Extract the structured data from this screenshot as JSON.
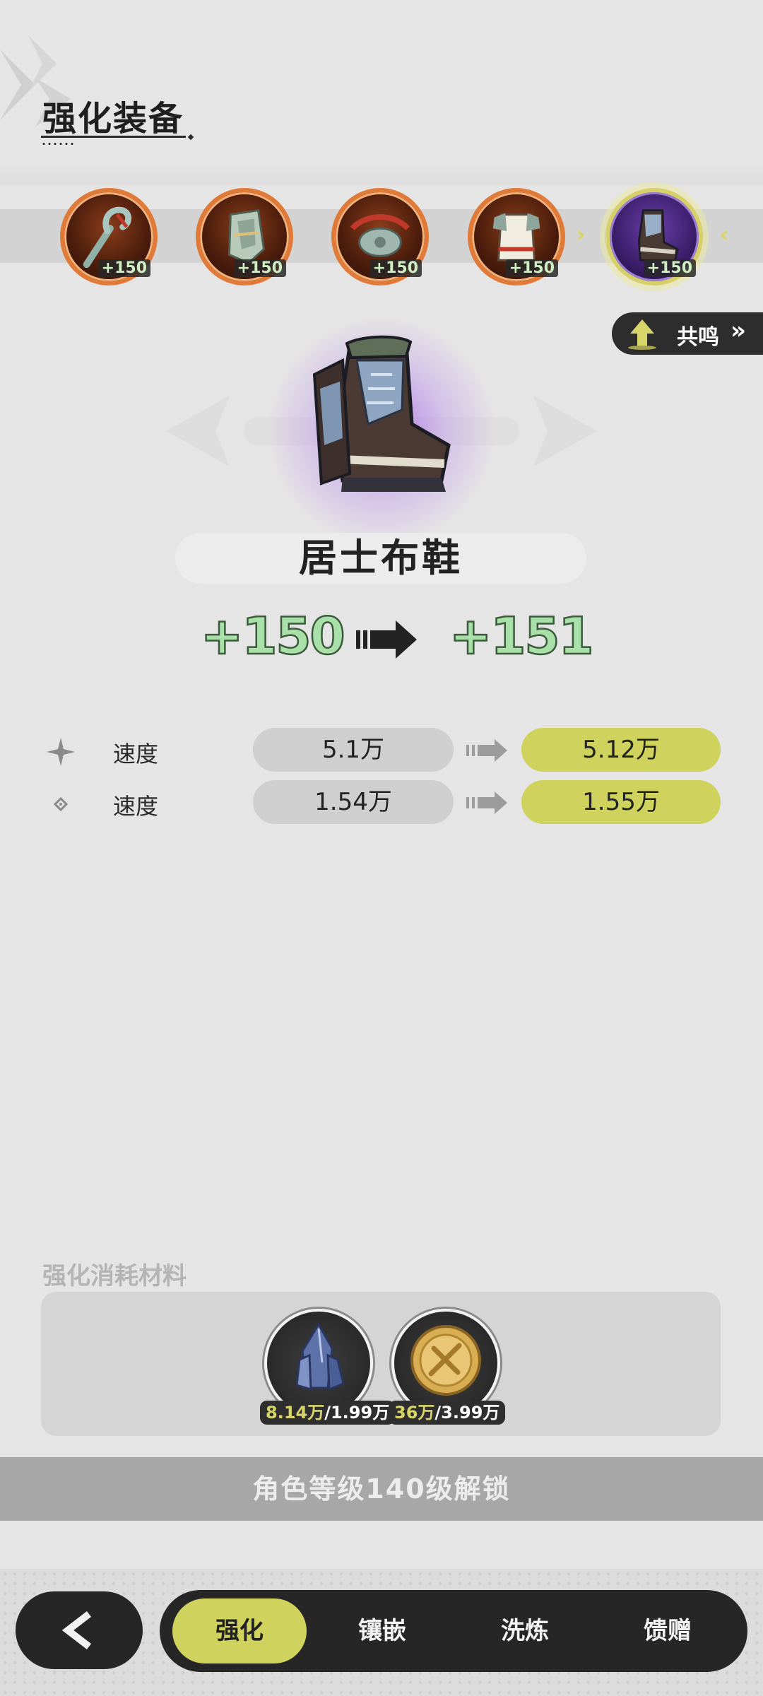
{
  "header": {
    "title": "强化装备"
  },
  "equipment_slots": [
    {
      "name": "staff",
      "level": "+150",
      "selected": false
    },
    {
      "name": "helmet",
      "level": "+150",
      "selected": false
    },
    {
      "name": "belt",
      "level": "+150",
      "selected": false
    },
    {
      "name": "armor",
      "level": "+150",
      "selected": false
    },
    {
      "name": "boots",
      "level": "+150",
      "selected": true
    }
  ],
  "resonance": {
    "label": "共鸣",
    "chevron": "»"
  },
  "item": {
    "name": "居士布鞋",
    "level_from": "+150",
    "level_to": "+151"
  },
  "stats": [
    {
      "icon": "sparkle-icon",
      "label": "速度",
      "old": "5.1万",
      "new": "5.12万"
    },
    {
      "icon": "diamond-icon",
      "label": "速度",
      "old": "1.54万",
      "new": "1.55万"
    }
  ],
  "materials": {
    "title": "强化消耗材料",
    "items": [
      {
        "icon": "crystal-icon",
        "have": "8.14万",
        "need": "/1.99万"
      },
      {
        "icon": "gold-coin-icon",
        "have": "36万",
        "need": "/3.99万"
      }
    ]
  },
  "unlock_message": "角色等级140级解锁",
  "nav": {
    "back_icon": "chevron-left-icon",
    "tabs": [
      "强化",
      "镶嵌",
      "洗炼",
      "馈赠"
    ],
    "active_tab": "强化"
  },
  "colors": {
    "accent": "#cfd25c",
    "slot_border": "#e07a38",
    "selected_slot_bg": "#3a1d68",
    "dark": "#262626"
  }
}
